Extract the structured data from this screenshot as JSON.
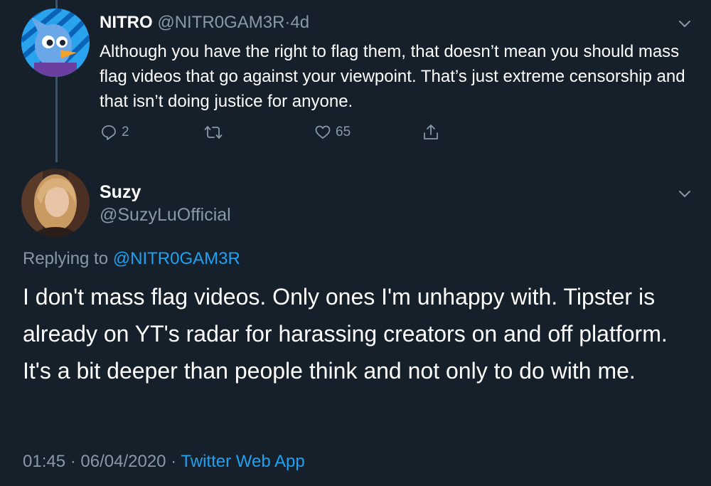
{
  "parent_tweet": {
    "display_name": "NITRO",
    "handle": "@NITR0GAM3R",
    "separator": "·",
    "age": "4d",
    "text": "Although you have the right to flag them, that doesn’t mean you should mass flag videos that go against your viewpoint. That’s just extreme censorship and that isn’t doing justice for anyone.",
    "reply_count": "2",
    "retweet_count": "",
    "like_count": "65"
  },
  "main_tweet": {
    "display_name": "Suzy",
    "handle": "@SuzyLuOfficial",
    "replying_prefix": "Replying to ",
    "replying_to": "@NITR0GAM3R",
    "text": "I don't mass flag videos. Only ones I'm unhappy with. Tipster is already on YT's radar for harassing creators on and off platform. It's a bit deeper than people think and not only to do with me.",
    "time": "01:45",
    "dot1": " · ",
    "date": "06/04/2020",
    "dot2": " · ",
    "source": "Twitter Web App"
  },
  "icons": {
    "more": "chevron-down-icon",
    "reply": "reply-icon",
    "retweet": "retweet-icon",
    "like": "heart-icon",
    "share": "share-icon"
  },
  "colors": {
    "background": "#15202b",
    "text": "#ffffff",
    "secondary": "#8899a6",
    "link": "#1da1f2",
    "thread_line": "#3d5466"
  }
}
